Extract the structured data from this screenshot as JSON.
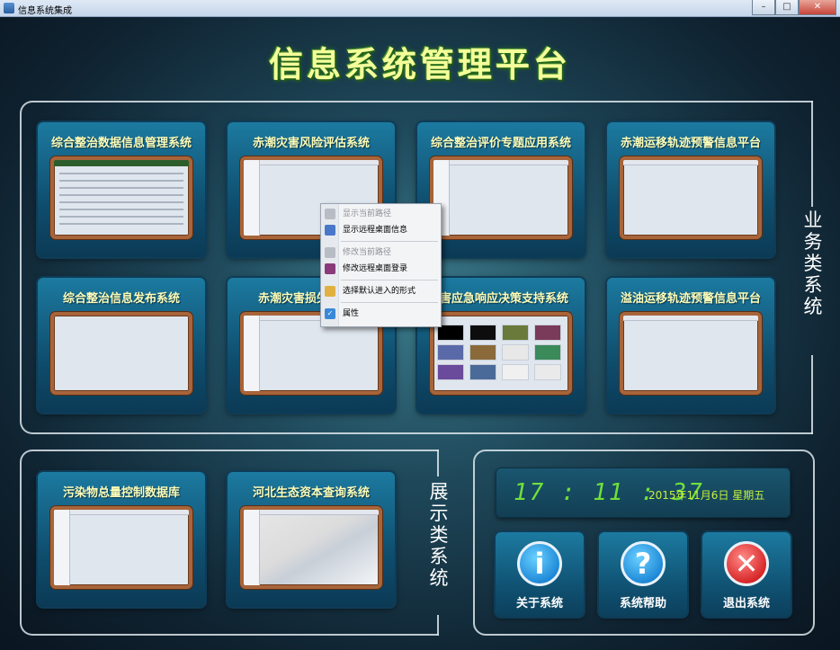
{
  "window": {
    "title": "信息系统集成",
    "minimize": "–",
    "maximize": "□",
    "close": "✕"
  },
  "main_title": "信息系统管理平台",
  "sections": {
    "business_label": "业务类系统",
    "display_label": "展示类系统"
  },
  "business_tiles": [
    {
      "title": "综合整治数据信息管理系统",
      "thumb": "table"
    },
    {
      "title": "赤潮灾害风险评估系统",
      "thumb": "map-sea"
    },
    {
      "title": "综合整治评价专题应用系统",
      "thumb": "map-sea"
    },
    {
      "title": "赤潮运移轨迹预警信息平台",
      "thumb": "satellite"
    },
    {
      "title": "综合整治信息发布系统",
      "thumb": "coast"
    },
    {
      "title": "赤潮灾害损失",
      "thumb": "coast"
    },
    {
      "title": "灾害应急响应决策支持系统",
      "thumb": "grid"
    },
    {
      "title": "溢油运移轨迹预警信息平台",
      "thumb": "satellite"
    }
  ],
  "display_tiles": [
    {
      "title": "污染物总量控制数据库",
      "thumb": "satellite"
    },
    {
      "title": "河北生态资本查询系统",
      "thumb": "coast"
    }
  ],
  "context_menu": [
    {
      "label": "显示当前路径",
      "disabled": true,
      "icon": "folder-icon"
    },
    {
      "label": "显示远程桌面信息",
      "disabled": false,
      "icon": "info-icon"
    },
    {
      "label": "修改当前路径",
      "disabled": true,
      "icon": "tools-icon"
    },
    {
      "label": "修改远程桌面登录",
      "disabled": false,
      "icon": "login-icon"
    },
    {
      "label": "选择默认进入的形式",
      "disabled": false,
      "icon": "folder-open-icon"
    },
    {
      "label": "属性",
      "disabled": false,
      "icon": "checkbox-icon"
    }
  ],
  "clock": {
    "time": "17 : 11 : 37",
    "date": "2015年11月6日  星期五"
  },
  "controls": {
    "about": "关于系统",
    "help": "系统帮助",
    "exit": "退出系统",
    "about_symbol": "i",
    "help_symbol": "?",
    "exit_symbol": "✕"
  },
  "colors": {
    "title": "#f4ff9a",
    "tile_title": "#fdfdb8",
    "clock": "#6fe03a",
    "date": "#c8f03a"
  }
}
